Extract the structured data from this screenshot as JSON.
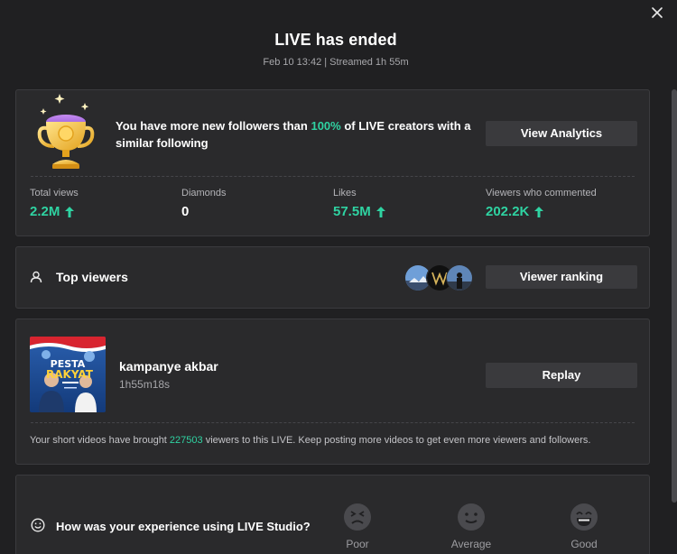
{
  "header": {
    "title": "LIVE has ended",
    "subtitle": "Feb 10 13:42 | Streamed 1h 55m"
  },
  "summary": {
    "followers_prefix": "You have more new followers than ",
    "followers_percent": "100%",
    "followers_suffix": " of LIVE creators with a similar following",
    "view_analytics_label": "View Analytics",
    "stats": [
      {
        "label": "Total views",
        "value": "2.2M",
        "trend": "up"
      },
      {
        "label": "Diamonds",
        "value": "0",
        "trend": "none"
      },
      {
        "label": "Likes",
        "value": "57.5M",
        "trend": "up"
      },
      {
        "label": "Viewers who commented",
        "value": "202.2K",
        "trend": "up"
      }
    ]
  },
  "top_viewers": {
    "label": "Top viewers",
    "icon": "user-icon",
    "button_label": "Viewer ranking"
  },
  "video": {
    "thumbnail_text_line1": "PESTA",
    "thumbnail_text_line2": "RAKYAT",
    "title": "kampanye akbar",
    "duration": "1h55m18s",
    "replay_label": "Replay",
    "short_videos_prefix": "Your short videos have brought ",
    "short_videos_count": "227503",
    "short_videos_suffix": " viewers to this LIVE. Keep posting more videos to get even more viewers and followers."
  },
  "feedback": {
    "question": "How was your experience using LIVE Studio?",
    "options": [
      {
        "label": "Poor",
        "icon": "frown-face-icon"
      },
      {
        "label": "Average",
        "icon": "neutral-face-icon"
      },
      {
        "label": "Good",
        "icon": "grin-face-icon"
      }
    ]
  },
  "colors": {
    "accent": "#2fd3a2",
    "background": "#202022",
    "card": "#2a2a2c",
    "button": "#3a3a3d"
  }
}
